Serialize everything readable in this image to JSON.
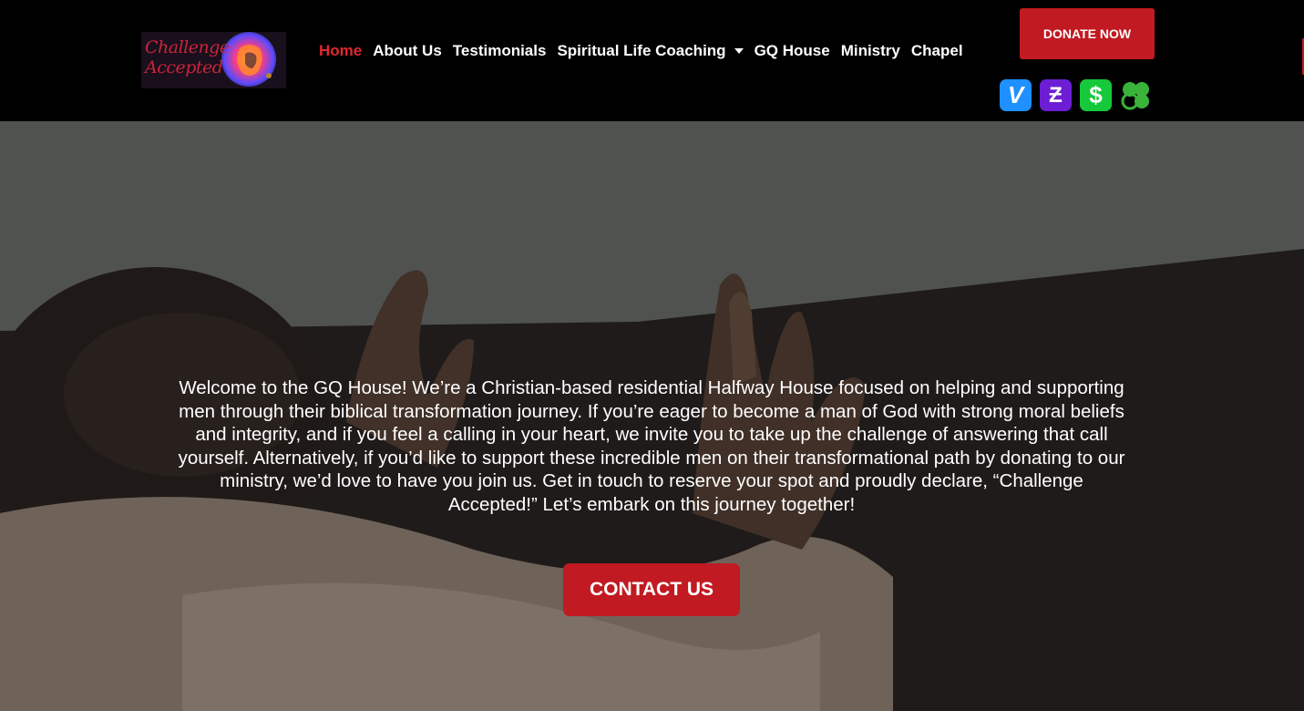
{
  "logo": {
    "text": "Challenge Accepted"
  },
  "nav": {
    "items": [
      {
        "label": "Home",
        "active": true
      },
      {
        "label": "About Us"
      },
      {
        "label": "Testimonials"
      },
      {
        "label": "Spiritual Life Coaching",
        "dropdown": true
      },
      {
        "label": "GQ House"
      },
      {
        "label": "Ministry"
      },
      {
        "label": "Chapel"
      }
    ]
  },
  "donate": {
    "label": "DONATE NOW"
  },
  "payment_icons": [
    {
      "icon": "venmo-icon",
      "glyph": "V",
      "color": "#1e90ff"
    },
    {
      "icon": "zelle-icon",
      "glyph": "Ƶ",
      "color": "#6d1ed4"
    },
    {
      "icon": "cash-app-icon",
      "glyph": "$",
      "color": "#16c93a"
    },
    {
      "icon": "clover-icon",
      "color": "#3ab33a"
    }
  ],
  "hero": {
    "text": "Welcome to the GQ House! We’re a Christian-based residential Halfway House focused on helping and supporting men through their biblical transformation journey. If you’re eager to become a man of God with strong moral beliefs and integrity, and if you feel a calling in your heart, we invite you to take up the challenge of answering that call yourself. Alternatively, if you’d like to support these incredible men on their transformational path by donating to our ministry, we’d love to have you join us. Get in touch to reserve your spot and proudly declare, “Challenge Accepted!” Let’s embark on this journey together!",
    "cta_label": "CONTACT US"
  },
  "colors": {
    "accent": "#c11a22",
    "nav_active": "#e0282f",
    "header_bg": "#000000"
  }
}
